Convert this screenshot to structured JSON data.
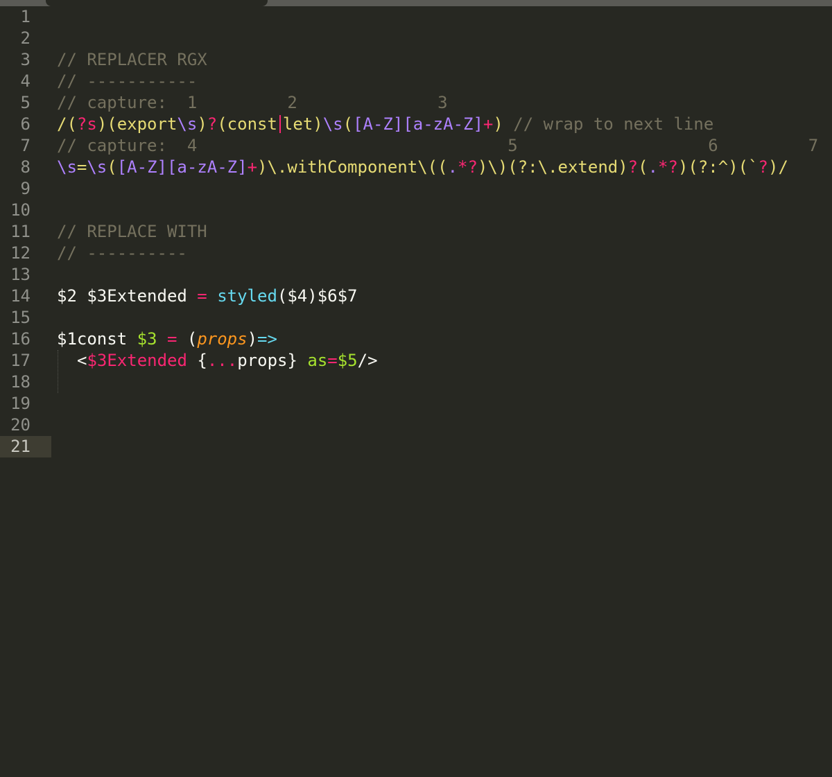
{
  "editor": {
    "line_numbers": [
      "1",
      "2",
      "3",
      "4",
      "5",
      "6",
      "7",
      "8",
      "9",
      "10",
      "11",
      "12",
      "13",
      "14",
      "15",
      "16",
      "17",
      "18",
      "19",
      "20",
      "21"
    ],
    "current_line": "21",
    "lines": {
      "l3": "// REPLACER RGX",
      "l4": "// -----------",
      "l5": "// capture:  1         2              3",
      "l6": {
        "p1": "/(",
        "p2": "?s",
        "p3": ")(export",
        "p4": "\\s",
        "p5": ")",
        "p6": "?",
        "p7": "(const",
        "p8": "let)",
        "p9": "\\s",
        "p10": "(",
        "p11": "[A-Z][a-zA-Z]",
        "p12": "+",
        "p13": ")",
        "p14": " // wrap to next line"
      },
      "l7": "// capture:  4                               5                   6         7",
      "l8": {
        "p1": "\\s",
        "p2": "=",
        "p3": "\\s",
        "p4": "(",
        "p5": "[A-Z][a-zA-Z]",
        "p6": "+",
        "p7": ")\\.withComponent\\((",
        "p8": ".",
        "p9": "*?",
        "p10": ")\\)",
        "p11": "(?:\\.extend)",
        "p12": "?",
        "p13": "(",
        "p14": ".",
        "p15": "*?",
        "p16": ")",
        "p17": "(?:^)",
        "p18": "(`",
        "p19": "?",
        "p20": ")/"
      },
      "l11": "// REPLACE WITH",
      "l12": "// ----------",
      "l14": {
        "p1": "$2 $3Extended ",
        "p2": "=",
        "p3": " styled",
        "p4": "($4)$6$7"
      },
      "l16": {
        "p1": "$1const ",
        "p2": "$3",
        "p3": " ",
        "p4": "=",
        "p5": " (",
        "p6": "props",
        "p7": ")",
        "p8": "=>"
      },
      "l17": {
        "p1": "<",
        "p2": "$3Extended",
        "p3": " {",
        "p4": "...",
        "p5": "props} ",
        "p6": "as",
        "p7": "=",
        "p8": "$5",
        "p9": "/>"
      }
    }
  },
  "colors": {
    "background": "#272822",
    "comment": "#75715e",
    "string": "#e6db74",
    "keyword": "#f92672",
    "constant": "#ae81ff",
    "support": "#66d9ef",
    "entity": "#a6e22e",
    "parameter": "#fd971f"
  }
}
